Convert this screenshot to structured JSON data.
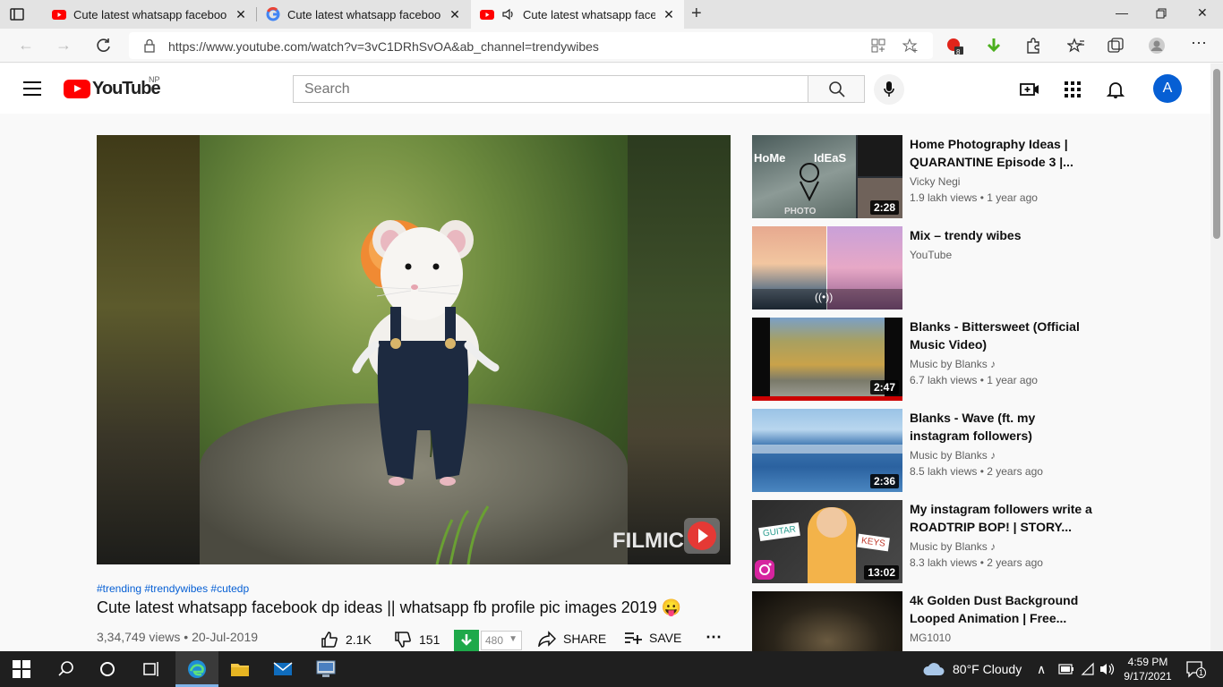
{
  "browser": {
    "tabs": [
      {
        "title": "Cute latest whatsapp facebook d",
        "favicon": "youtube-icon",
        "close": "✕"
      },
      {
        "title": "Cute latest whatsapp facebook d",
        "favicon": "google-icon",
        "close": "✕"
      },
      {
        "title": "Cute latest whatsapp facebo",
        "favicon": "youtube-icon",
        "close": "✕",
        "active": true
      }
    ],
    "url": "https://www.youtube.com/watch?v=3vC1DRhSvOA&ab_channel=trendywibes",
    "extension_badge": "8"
  },
  "youtube": {
    "logo_text": "YouTube",
    "region": "NP",
    "search_placeholder": "Search",
    "avatar_letter": "A"
  },
  "video": {
    "hashtags": "#trending #trendywibes #cutedp",
    "title": "Cute latest whatsapp facebook dp ideas || whatsapp fb profile pic images 2019 😛",
    "views": "3,34,749 views",
    "date": "20-Jul-2019",
    "likes": "2.1K",
    "dislikes": "151",
    "download_count": "480",
    "share_label": "SHARE",
    "save_label": "SAVE",
    "watermark": "FILMIC"
  },
  "recommendations": [
    {
      "title": "Home Photography Ideas | QUARANTINE Episode 3 |...",
      "channel": "Vicky Negi",
      "stats": "1.9 lakh views • 1 year ago",
      "duration": "2:28"
    },
    {
      "title": "Mix – trendy wibes",
      "channel": "YouTube",
      "stats": "",
      "duration": ""
    },
    {
      "title": "Blanks - Bittersweet (Official Music Video)",
      "channel": "Music by Blanks",
      "stats": "6.7 lakh views • 1 year ago",
      "duration": "2:47"
    },
    {
      "title": "Blanks - Wave (ft. my instagram followers)",
      "channel": "Music by Blanks",
      "stats": "8.5 lakh views • 2 years ago",
      "duration": "2:36"
    },
    {
      "title": "My instagram followers write a ROADTRIP BOP! | STORY...",
      "channel": "Music by Blanks",
      "stats": "8.3 lakh views • 2 years ago",
      "duration": "13:02"
    },
    {
      "title": "4k Golden Dust Background Looped Animation | Free...",
      "channel": "MG1010",
      "stats": "",
      "duration": ""
    }
  ],
  "thumb_text": {
    "home_ideas": "HoMe IdEaS",
    "photo": "PHOTO",
    "guitar": "GUITAR",
    "keys": "KEYS"
  },
  "taskbar": {
    "weather": "80°F  Cloudy",
    "time": "4:59 PM",
    "date": "9/17/2021",
    "notifications": "1"
  }
}
